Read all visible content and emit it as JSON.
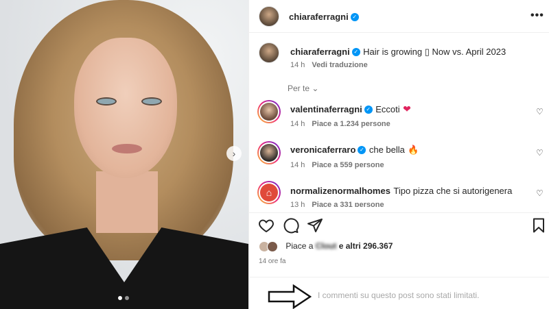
{
  "header": {
    "username": "chiaraferragni",
    "more_label": "•••"
  },
  "caption": {
    "username": "chiaraferragni",
    "text": "Hair is growing ▯ Now vs. April 2023",
    "time": "14 h",
    "translate": "Vedi traduzione"
  },
  "filter": {
    "label": "Per te"
  },
  "comments": [
    {
      "username": "valentinaferragni",
      "verified": true,
      "text": "Eccoti",
      "emoji": "heart",
      "time": "14 h",
      "likes": "Piace a 1.234 persone"
    },
    {
      "username": "veronicaferraro",
      "verified": true,
      "text": "che bella",
      "emoji": "fire",
      "time": "14 h",
      "likes": "Piace a 559 persone"
    },
    {
      "username": "normalizenormalhomes",
      "verified": false,
      "text": "Tipo pizza che si autorigenera",
      "time": "13 h",
      "likes": "Piace a 331 persone"
    }
  ],
  "likes": {
    "prefix": "Piace a ",
    "censored": "Clout",
    "suffix": " e altri 296.367"
  },
  "post_time": "14 ore fa",
  "comments_limited": "I commenti su questo post sono stati limitati.",
  "colors": {
    "verified": "#0095f6",
    "text": "#262626",
    "secondary": "#737373",
    "heart_red": "#e0245e"
  }
}
